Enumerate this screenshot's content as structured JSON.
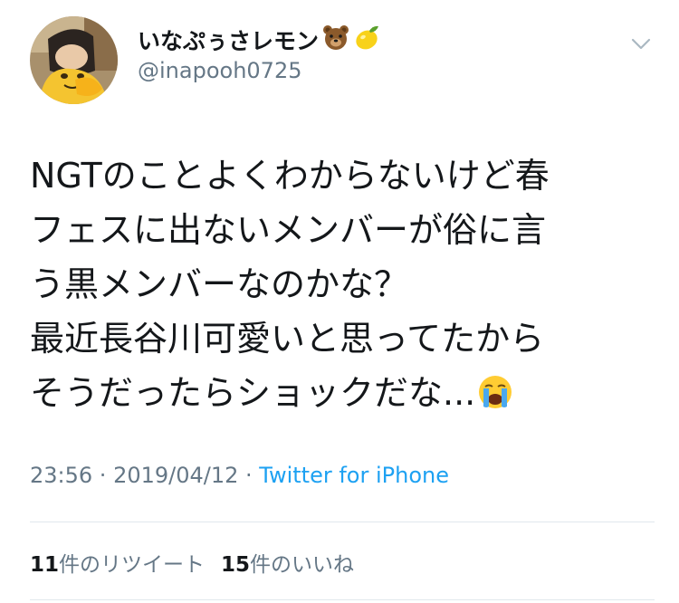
{
  "tweet": {
    "author_name": "いなぷぅさレモン",
    "author_emoji": [
      "bear-face-icon",
      "lemon-icon"
    ],
    "handle": "@inapooh0725",
    "text_lines": [
      "NGTのことよくわからないけど春",
      "フェスに出ないメンバーが俗に言",
      "う黒メンバーなのかな？",
      "最近長谷川可愛いと思ってたから",
      "そうだったらショックだな..."
    ],
    "trailing_emoji": "crying-face-icon",
    "time": "23:56",
    "separator": " · ",
    "date": "2019/04/12",
    "separator2": " · ",
    "source": "Twitter for iPhone"
  },
  "stats": {
    "retweets_count": "11",
    "retweets_label": "件のリツイート",
    "likes_count": "15",
    "likes_label": "件のいいね"
  },
  "colors": {
    "text": "#14171a",
    "muted": "#657786",
    "link": "#1da1f2",
    "divider": "#e1e8ed"
  }
}
